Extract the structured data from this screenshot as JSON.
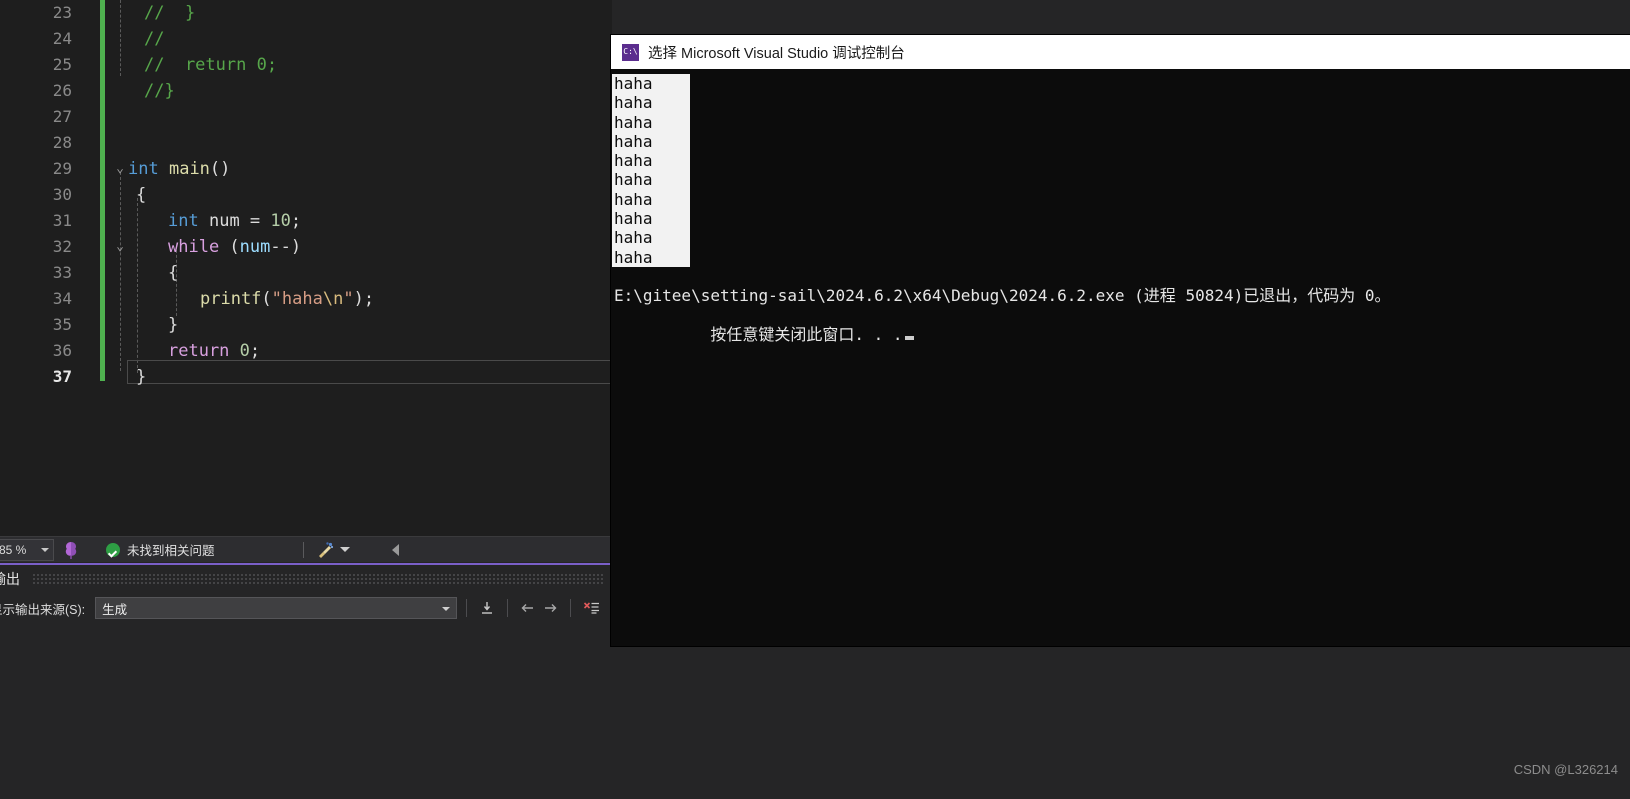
{
  "editor": {
    "name": "visual-studio-code-editor",
    "lines": [
      {
        "num": "23",
        "fold": "",
        "tokens": [
          {
            "t": "//  }",
            "c": "t-comment"
          }
        ],
        "indent": 16
      },
      {
        "num": "24",
        "fold": "",
        "tokens": [
          {
            "t": "//",
            "c": "t-comment"
          }
        ],
        "indent": 16
      },
      {
        "num": "25",
        "fold": "",
        "tokens": [
          {
            "t": "//  return 0;",
            "c": "t-comment"
          }
        ],
        "indent": 16
      },
      {
        "num": "26",
        "fold": "",
        "tokens": [
          {
            "t": "//}",
            "c": "t-comment"
          }
        ],
        "indent": 16
      },
      {
        "num": "27",
        "fold": "",
        "tokens": [],
        "indent": 16
      },
      {
        "num": "28",
        "fold": "",
        "tokens": [],
        "indent": 16
      },
      {
        "num": "29",
        "fold": "v",
        "tokens": [
          {
            "t": "int",
            "c": "t-key"
          },
          {
            "t": " ",
            "c": "t-punct"
          },
          {
            "t": "main",
            "c": "t-fn"
          },
          {
            "t": "()",
            "c": "t-punct"
          }
        ],
        "indent": 0
      },
      {
        "num": "30",
        "fold": "",
        "tokens": [
          {
            "t": "{",
            "c": "t-punct"
          }
        ],
        "indent": 8
      },
      {
        "num": "31",
        "fold": "",
        "tokens": [
          {
            "t": "int",
            "c": "t-key"
          },
          {
            "t": " ",
            "c": "t-punct"
          },
          {
            "t": "num",
            "c": "t-punct"
          },
          {
            "t": " = ",
            "c": "t-punct"
          },
          {
            "t": "10",
            "c": "t-num"
          },
          {
            "t": ";",
            "c": "t-punct"
          }
        ],
        "indent": 40
      },
      {
        "num": "32",
        "fold": "v",
        "tokens": [
          {
            "t": "while",
            "c": "t-ctrl"
          },
          {
            "t": " (",
            "c": "t-punct"
          },
          {
            "t": "num",
            "c": "t-var"
          },
          {
            "t": "--)",
            "c": "t-punct"
          }
        ],
        "indent": 40
      },
      {
        "num": "33",
        "fold": "",
        "tokens": [
          {
            "t": "{",
            "c": "t-punct"
          }
        ],
        "indent": 40
      },
      {
        "num": "34",
        "fold": "",
        "tokens": [
          {
            "t": "printf",
            "c": "t-fn"
          },
          {
            "t": "(",
            "c": "t-punct"
          },
          {
            "t": "\"haha",
            "c": "t-str"
          },
          {
            "t": "\\n",
            "c": "t-esc"
          },
          {
            "t": "\"",
            "c": "t-str"
          },
          {
            "t": ");",
            "c": "t-punct"
          }
        ],
        "indent": 72
      },
      {
        "num": "35",
        "fold": "",
        "tokens": [
          {
            "t": "}",
            "c": "t-punct"
          }
        ],
        "indent": 40
      },
      {
        "num": "36",
        "fold": "",
        "tokens": [
          {
            "t": "return",
            "c": "t-ctrl"
          },
          {
            "t": " ",
            "c": "t-punct"
          },
          {
            "t": "0",
            "c": "t-num"
          },
          {
            "t": ";",
            "c": "t-punct"
          }
        ],
        "indent": 40
      },
      {
        "num": "37",
        "fold": "",
        "tokens": [
          {
            "t": "}",
            "c": "t-punct"
          }
        ],
        "indent": 8,
        "current": true
      }
    ]
  },
  "status_bar": {
    "zoom_level": "85 %",
    "issues_text": "未找到相关问题",
    "brain_icon": "intellicode-icon",
    "brush_icon": "brush-icon",
    "collapse_icon": "left-arrow-icon"
  },
  "output_panel": {
    "title": "输出",
    "source_label": "显示输出来源(S):",
    "source_value": "生成",
    "toolbar_icons": [
      "jump-to-icon",
      "previous-message-icon",
      "next-message-icon",
      "clear-output-icon"
    ]
  },
  "console": {
    "icon": "cmd-prompt-icon",
    "icon_text": "C:\\",
    "title": "选择 Microsoft Visual Studio 调试控制台",
    "output_lines": [
      "haha",
      "haha",
      "haha",
      "haha",
      "haha",
      "haha",
      "haha",
      "haha",
      "haha",
      "haha"
    ],
    "exit_line": "E:\\gitee\\setting-sail\\2024.6.2\\x64\\Debug\\2024.6.2.exe (进程 50824)已退出，代码为 0。",
    "prompt_line": "按任意键关闭此窗口. . ."
  },
  "watermark": {
    "text": "CSDN @L326214"
  },
  "colors": {
    "editor_bg": "#1e1e1e",
    "panel_bg": "#252526",
    "change_bar": "#4fb14f",
    "output_accent": "#7a5fc8",
    "console_bg": "#0c0c0c",
    "selection_bg": "#f2f2f2"
  }
}
